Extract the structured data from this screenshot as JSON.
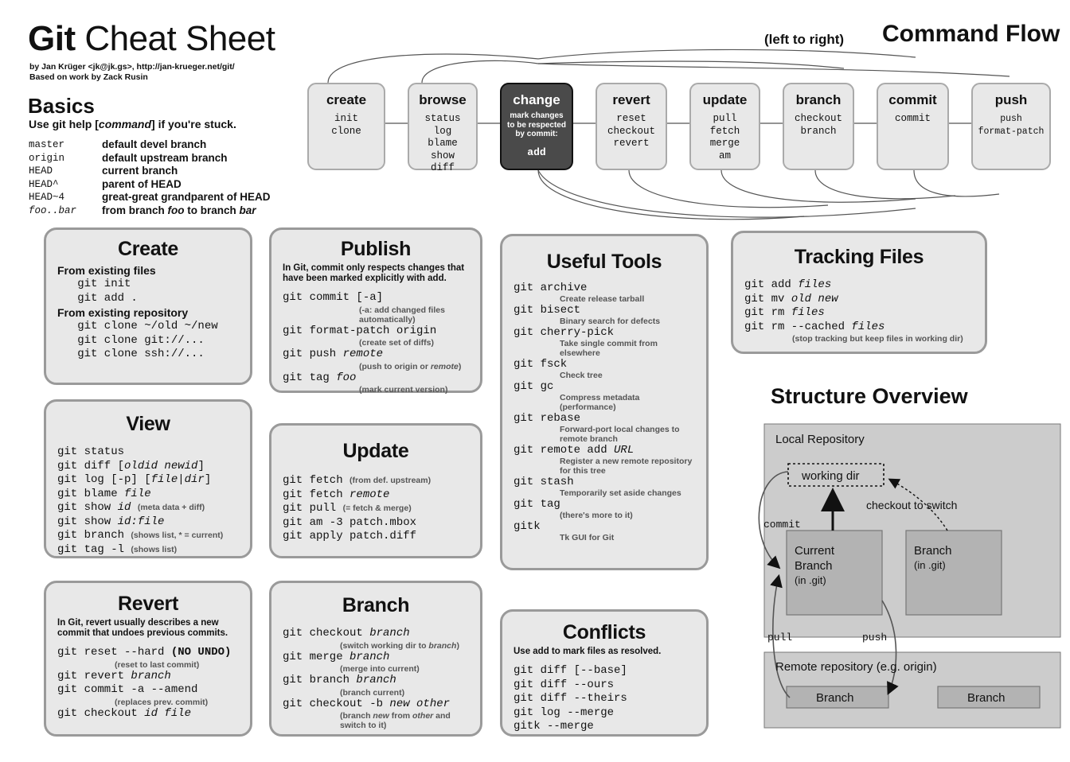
{
  "header": {
    "title_bold": "Git",
    "title_rest": " Cheat Sheet",
    "byline_1": "by Jan Krüger <jk@jk.gs>, http://jan-krueger.net/git/",
    "byline_2": "Based on work by Zack Rusin"
  },
  "basics": {
    "heading": "Basics",
    "subtitle": "Use git help [command] if you're stuck.",
    "rows": [
      {
        "term": "master",
        "desc": "default devel branch"
      },
      {
        "term": "origin",
        "desc": "default upstream branch"
      },
      {
        "term": "HEAD",
        "desc": "current branch"
      },
      {
        "term": "HEAD^",
        "desc": "parent of HEAD"
      },
      {
        "term": "HEAD~4",
        "desc": "great-great grandparent of HEAD"
      },
      {
        "term": "foo..bar",
        "desc": "from branch foo to branch bar"
      }
    ]
  },
  "command_flow": {
    "direction_note": "(left to right)",
    "title": "Command Flow",
    "boxes": [
      {
        "name": "create",
        "cmds": "init\nclone"
      },
      {
        "name": "browse",
        "cmds": "status\nlog\nblame\nshow\ndiff"
      },
      {
        "name": "change",
        "desc": "mark changes\nto be respected\nby commit:",
        "cmds": "add",
        "dark": true
      },
      {
        "name": "revert",
        "cmds": "reset\ncheckout\nrevert"
      },
      {
        "name": "update",
        "cmds": "pull\nfetch\nmerge\nam"
      },
      {
        "name": "branch",
        "cmds": "checkout\nbranch"
      },
      {
        "name": "commit",
        "cmds": "commit"
      },
      {
        "name": "push",
        "cmds": "push\nformat-patch"
      }
    ]
  },
  "cards": {
    "create": {
      "title": "Create",
      "lines": [
        {
          "t": "From existing files",
          "style": "hdr"
        },
        {
          "t": "   git init"
        },
        {
          "t": "   git add ."
        },
        {
          "t": "From existing repository",
          "style": "hdr"
        },
        {
          "t": "   git clone ~/old ~/new"
        },
        {
          "t": "   git clone git://..."
        },
        {
          "t": "   git clone ssh://..."
        }
      ]
    },
    "publish": {
      "title": "Publish",
      "intro": "In Git, commit only respects changes that have been marked explicitly with add.",
      "lines": [
        {
          "t": "git commit [-a]"
        },
        {
          "t": "(-a: add changed files automatically)",
          "style": "sub",
          "indent": 96
        },
        {
          "t": "git format-patch origin"
        },
        {
          "t": "(create set of diffs)",
          "style": "sub",
          "indent": 96
        },
        {
          "t": "git push remote",
          "italic_from": 9
        },
        {
          "t": "(push to origin or remote)",
          "style": "sub",
          "indent": 96
        },
        {
          "t": "git tag foo",
          "italic_from": 8
        },
        {
          "t": "(mark current version)",
          "style": "sub",
          "indent": 96
        }
      ]
    },
    "useful_tools": {
      "title": "Useful Tools",
      "entries": [
        {
          "cmd": "git archive",
          "desc": "Create release tarball"
        },
        {
          "cmd": "git bisect",
          "desc": "Binary search for defects"
        },
        {
          "cmd": "git cherry-pick",
          "desc": "Take single commit from elsewhere"
        },
        {
          "cmd": "git fsck",
          "desc": "Check tree"
        },
        {
          "cmd": "git gc",
          "desc": "Compress metadata (performance)"
        },
        {
          "cmd": "git rebase",
          "desc": "Forward-port local changes to remote branch"
        },
        {
          "cmd": "git remote add URL",
          "desc": "Register a new remote repository for this tree",
          "italic_from": 15
        },
        {
          "cmd": "git stash",
          "desc": "Temporarily set aside changes"
        },
        {
          "cmd": "git tag",
          "desc": "(there's more to it)"
        },
        {
          "cmd": "gitk",
          "desc": "Tk GUI for Git"
        }
      ]
    },
    "tracking_files": {
      "title": "Tracking Files",
      "lines": [
        {
          "t": "git add files",
          "italic_from": 8
        },
        {
          "t": "git mv old new",
          "italic_from": 7
        },
        {
          "t": "git rm files",
          "italic_from": 7
        },
        {
          "t": "git rm --cached files",
          "italic_from": 16
        },
        {
          "t": "(stop tracking but keep files in working dir)",
          "style": "sub",
          "indent": 60
        }
      ]
    },
    "view": {
      "title": "View",
      "lines": [
        {
          "t": "git status"
        },
        {
          "t": "git diff [oldid newid]"
        },
        {
          "t": "git log [-p] [file|dir]"
        },
        {
          "t": "git blame file"
        },
        {
          "t": "git show id",
          "note": "(meta data + diff)"
        },
        {
          "t": "git show id:file"
        },
        {
          "t": "git branch",
          "note": "(shows list, * = current)"
        },
        {
          "t": "git tag -l",
          "note": "(shows list)"
        }
      ]
    },
    "update": {
      "title": "Update",
      "lines": [
        {
          "t": "git fetch",
          "note": "(from def. upstream)"
        },
        {
          "t": "git fetch remote"
        },
        {
          "t": "git pull",
          "note": "(= fetch & merge)"
        },
        {
          "t": "git am -3 patch.mbox"
        },
        {
          "t": "git apply patch.diff"
        }
      ]
    },
    "revert": {
      "title": "Revert",
      "intro": "In Git, revert usually describes a new commit that undoes previous commits.",
      "lines": [
        {
          "t": "git reset --hard (NO UNDO)"
        },
        {
          "t": "(reset to last commit)",
          "style": "sub",
          "indent": 72
        },
        {
          "t": "git revert branch"
        },
        {
          "t": "git commit -a --amend"
        },
        {
          "t": "(replaces prev. commit)",
          "style": "sub",
          "indent": 72
        },
        {
          "t": "git checkout id file"
        }
      ]
    },
    "branch": {
      "title": "Branch",
      "lines": [
        {
          "t": "git checkout branch"
        },
        {
          "t": "(switch working dir to branch)",
          "style": "sub",
          "indent": 72
        },
        {
          "t": "git merge branch"
        },
        {
          "t": "(merge into current)",
          "style": "sub",
          "indent": 72
        },
        {
          "t": "git branch branch"
        },
        {
          "t": "(branch current)",
          "style": "sub",
          "indent": 72
        },
        {
          "t": "git checkout -b new other"
        },
        {
          "t": "(branch new from other and switch to it)",
          "style": "sub",
          "indent": 72
        }
      ]
    },
    "conflicts": {
      "title": "Conflicts",
      "intro": "Use add to mark files as resolved.",
      "lines": [
        {
          "t": "git diff [--base]"
        },
        {
          "t": "git diff --ours"
        },
        {
          "t": "git diff --theirs"
        },
        {
          "t": "git log --merge"
        },
        {
          "t": "gitk --merge"
        }
      ]
    }
  },
  "structure_overview": {
    "title": "Structure Overview",
    "local_repo_label": "Local Repository",
    "remote_repo_label": "Remote repository (e.g. origin)",
    "working_dir_label": "working dir",
    "current_branch_label": "Current\nBranch\n(in .git)",
    "current_branch_l1": "Current",
    "current_branch_l2": "Branch",
    "current_branch_l3": "(in .git)",
    "branch_box_l1": "Branch",
    "branch_box_l2": "(in .git)",
    "remote_branch_1": "Branch",
    "remote_branch_2": "Branch",
    "arrow_commit": "commit",
    "arrow_checkout": "checkout to switch",
    "arrow_pull": "pull",
    "arrow_push": "push"
  },
  "colors": {
    "card_bg": "#e8e8e8",
    "card_border": "#9a9a9a",
    "flow_box_bg": "#e8e8e8",
    "flow_box_border": "#aaaaaa",
    "flow_dark_bg": "#4a4a4a",
    "so_outer_bg": "#cccccc",
    "so_inner_bg": "#b3b3b3"
  }
}
